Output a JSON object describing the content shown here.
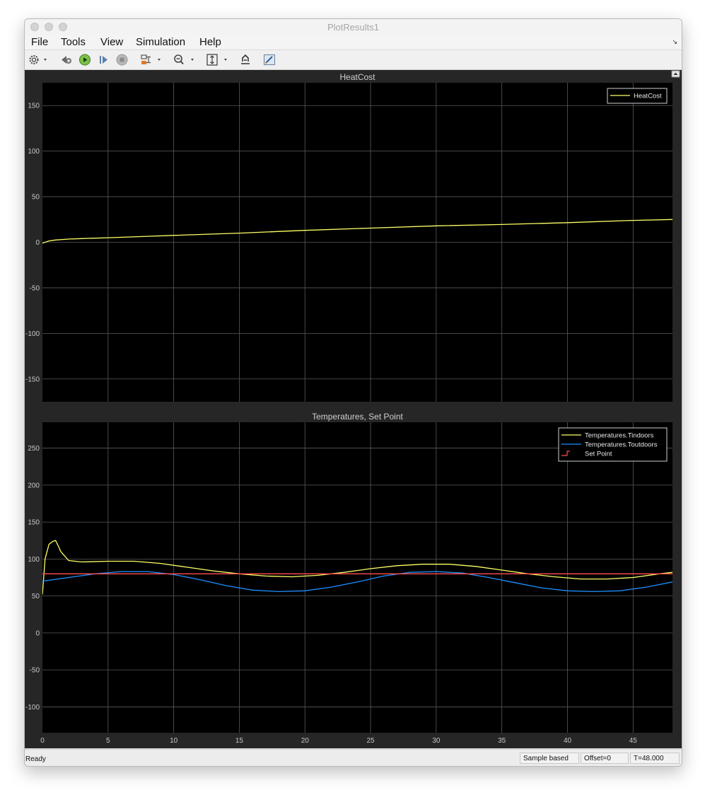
{
  "window": {
    "title": "PlotResults1"
  },
  "menu": {
    "file": "File",
    "tools": "Tools",
    "view": "View",
    "simulation": "Simulation",
    "help": "Help"
  },
  "toolbar": {
    "icons": [
      "gear-icon",
      "step-back-icon",
      "run-icon",
      "step-forward-icon",
      "stop-icon",
      "signal-select-icon",
      "zoom-icon",
      "autoscale-icon",
      "restore-icon",
      "style-icon"
    ]
  },
  "status": {
    "text": "Ready",
    "mode": "Sample based",
    "offset": "Offset=0",
    "time": "T=48.000"
  },
  "colors": {
    "background": "#262626",
    "axes": "#000000",
    "grid": "#5a5a5a",
    "yellow": "#ffff66",
    "blue": "#1e90ff",
    "red": "#ff4d4d"
  },
  "chart_data": [
    {
      "type": "line",
      "title": "HeatCost",
      "xlim": [
        0,
        48
      ],
      "ylim": [
        -175,
        175
      ],
      "xticks": [
        0,
        5,
        10,
        15,
        20,
        25,
        30,
        35,
        40,
        45
      ],
      "yticks": [
        -150,
        -100,
        -50,
        0,
        50,
        100,
        150
      ],
      "grid": true,
      "legend_position": "top-right",
      "series": [
        {
          "name": "HeatCost",
          "color": "#ffff66",
          "x": [
            0,
            0.5,
            1,
            2,
            3,
            5,
            8,
            10,
            15,
            20,
            25,
            30,
            35,
            40,
            45,
            48
          ],
          "y": [
            -1,
            1.5,
            2.5,
            3.5,
            4,
            5,
            6.5,
            7.5,
            10,
            13,
            15.5,
            18,
            19.5,
            21.5,
            24,
            25
          ]
        }
      ]
    },
    {
      "type": "line",
      "title": "Temperatures, Set Point",
      "xlim": [
        0,
        48
      ],
      "ylim": [
        -135,
        285
      ],
      "xticks": [
        0,
        5,
        10,
        15,
        20,
        25,
        30,
        35,
        40,
        45
      ],
      "yticks": [
        -100,
        -50,
        0,
        50,
        100,
        150,
        200,
        250
      ],
      "grid": true,
      "legend_position": "top-right",
      "series": [
        {
          "name": "Temperatures.Tindoors",
          "color": "#ffff66",
          "x": [
            0,
            0.2,
            0.5,
            0.8,
            1,
            1.2,
            1.4,
            1.6,
            2,
            3,
            5,
            7,
            9,
            11,
            13,
            15,
            17,
            19,
            21,
            23,
            25,
            27,
            29,
            31,
            33,
            35,
            37,
            39,
            41,
            43,
            45,
            47,
            48
          ],
          "y": [
            52,
            100,
            120,
            124,
            125,
            118,
            110,
            106,
            98,
            96,
            97,
            97,
            94,
            89,
            84,
            80,
            77,
            76,
            78,
            82,
            87,
            91,
            93,
            93,
            90,
            85,
            80,
            76,
            73,
            73,
            75,
            80,
            82
          ]
        },
        {
          "name": "Temperatures.Toutdoors",
          "color": "#1e90ff",
          "x": [
            0,
            2,
            4,
            6,
            8,
            10,
            12,
            14,
            16,
            18,
            20,
            22,
            24,
            26,
            28,
            30,
            32,
            34,
            36,
            38,
            40,
            42,
            44,
            46,
            48
          ],
          "y": [
            70,
            75,
            80,
            83,
            83,
            79,
            72,
            64,
            58,
            56,
            57,
            62,
            69,
            77,
            82,
            83,
            81,
            75,
            68,
            61,
            57,
            56,
            57,
            62,
            69
          ]
        },
        {
          "name": "Set Point",
          "color": "#ff4d4d",
          "x": [
            0,
            48
          ],
          "y": [
            80,
            80
          ]
        }
      ]
    }
  ]
}
